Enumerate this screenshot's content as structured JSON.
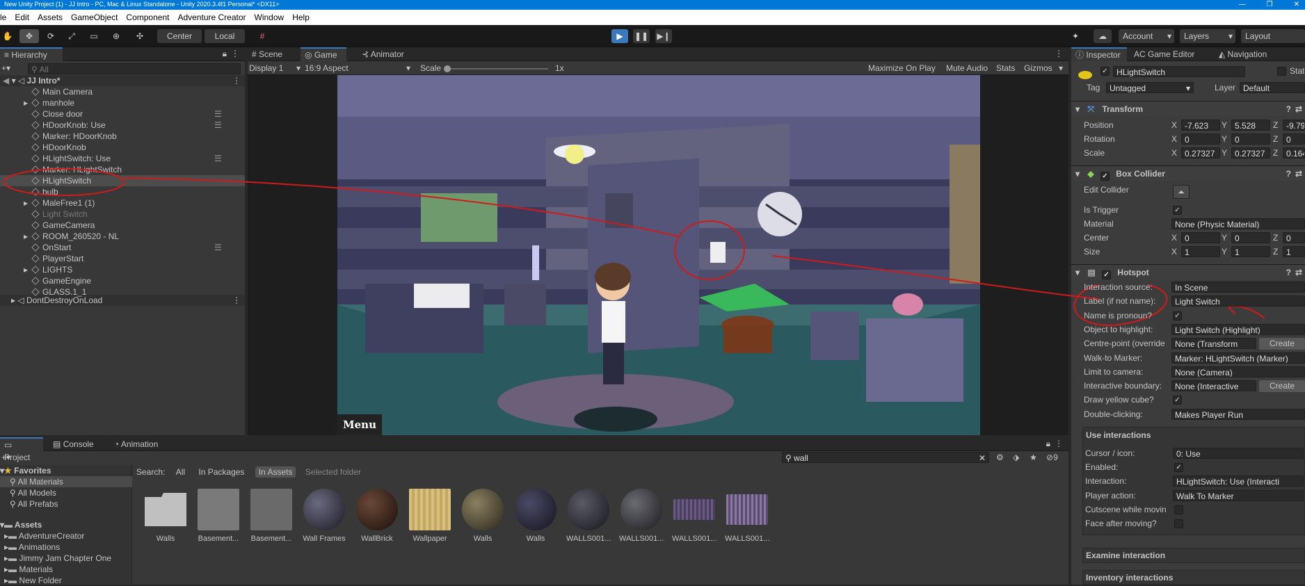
{
  "window": {
    "title": "New Unity Project (1) - JJ Intro - PC, Mac & Linux Standalone - Unity 2020.3.4f1 Personal* <DX11>",
    "minimize": "—",
    "maximize": "❐",
    "close": "✕"
  },
  "menu": [
    "le",
    "Edit",
    "Assets",
    "GameObject",
    "Component",
    "Adventure Creator",
    "Window",
    "Help"
  ],
  "toolbar": {
    "pivot": "Center",
    "space": "Local",
    "account": "Account",
    "layers": "Layers",
    "layout": "Layout"
  },
  "hierarchy": {
    "tab": "Hierarchy",
    "search_placeholder": "All",
    "scene": "JJ Intro*",
    "items": [
      "Main Camera",
      "manhole",
      "Close door",
      "HDoorKnob: Use",
      "Marker: HDoorKnob",
      "HDoorKnob",
      "HLightSwitch: Use",
      "Marker: HLightSwitch",
      "HLightSwitch",
      "bulb",
      "MaleFree1 (1)",
      "Light Switch",
      "GameCamera",
      "ROOM_260520 - NL",
      "OnStart",
      "PlayerStart",
      "LIGHTS",
      "GameEngine",
      "GLASS.1_1"
    ],
    "ddol": "DontDestroyOnLoad"
  },
  "game": {
    "tabs": [
      "Scene",
      "Game",
      "Animator"
    ],
    "display": "Display 1",
    "aspect": "16:9 Aspect",
    "scale_label": "Scale",
    "scale_value": "1x",
    "maximize": "Maximize On Play",
    "mute": "Mute Audio",
    "stats": "Stats",
    "gizmos": "Gizmos",
    "menu_button": "Menu"
  },
  "inspector": {
    "tabs": [
      "Inspector",
      "AC Game Editor",
      "Navigation"
    ],
    "object_name": "HLightSwitch",
    "static": "Stat",
    "tag_label": "Tag",
    "tag": "Untagged",
    "layer_label": "Layer",
    "layer": "Default",
    "transform": {
      "title": "Transform",
      "position": "Position",
      "rotation": "Rotation",
      "scale": "Scale",
      "px": "-7.623",
      "py": "5.528",
      "pz": "-9.79",
      "rx": "0",
      "ry": "0",
      "rz": "0",
      "sx": "0.27327",
      "sy": "0.27327",
      "sz": "0.164"
    },
    "collider": {
      "title": "Box Collider",
      "edit": "Edit Collider",
      "trigger": "Is Trigger",
      "material": "Material",
      "material_value": "None (Physic Material)",
      "center": "Center",
      "size": "Size",
      "cx": "0",
      "cy": "0",
      "cz": "0",
      "szx": "1",
      "szy": "1",
      "szz": "1"
    },
    "hotspot": {
      "title": "Hotspot",
      "rows": [
        [
          "Interaction source:",
          "In Scene"
        ],
        [
          "Label (if not name):",
          "Light Switch"
        ],
        [
          "Name is pronoun?",
          ""
        ],
        [
          "Object to highlight:",
          "Light Switch (Highlight)"
        ],
        [
          "Centre-point (override",
          "None (Transform"
        ],
        [
          "Walk-to Marker:",
          "Marker: HLightSwitch (Marker)"
        ],
        [
          "Limit to camera:",
          "None (Camera)"
        ],
        [
          "Interactive boundary:",
          "None (Interactive"
        ],
        [
          "Draw yellow cube?",
          ""
        ],
        [
          "Double-clicking:",
          "Makes Player Run"
        ]
      ],
      "create": "Create",
      "use_title": "Use interactions",
      "use_rows": [
        [
          "Cursor / icon:",
          "0: Use"
        ],
        [
          "Enabled:",
          ""
        ],
        [
          "Interaction:",
          "HLightSwitch: Use (Interacti"
        ],
        [
          "Player action:",
          "Walk To Marker"
        ],
        [
          "Cutscene while movin",
          ""
        ],
        [
          "Face after moving?",
          ""
        ]
      ],
      "examine": "Examine interaction",
      "inventory": "Inventory interactions"
    }
  },
  "project": {
    "tabs": [
      "Project",
      "Console",
      "Animation"
    ],
    "search": "wall",
    "hidden_count": "9",
    "favorites": "Favorites",
    "fav_items": [
      "All Materials",
      "All Models",
      "All Prefabs"
    ],
    "assets": "Assets",
    "folders": [
      "AdventureCreator",
      "Animations",
      "Jimmy Jam Chapter One",
      "Materials",
      "New Folder"
    ],
    "search_label": "Search:",
    "filters": [
      "All",
      "In Packages",
      "In Assets",
      "Selected folder"
    ],
    "items": [
      "Walls",
      "Basement...",
      "Basement...",
      "Wall Frames",
      "WallBrick",
      "Wallpaper",
      "Walls",
      "Walls",
      "WALLS001...",
      "WALLS001...",
      "WALLS001...",
      "WALLS001..."
    ]
  },
  "colors": {
    "accent": "#3a79bb",
    "annotation": "#d11a1a",
    "selected": "#2c5d87"
  }
}
